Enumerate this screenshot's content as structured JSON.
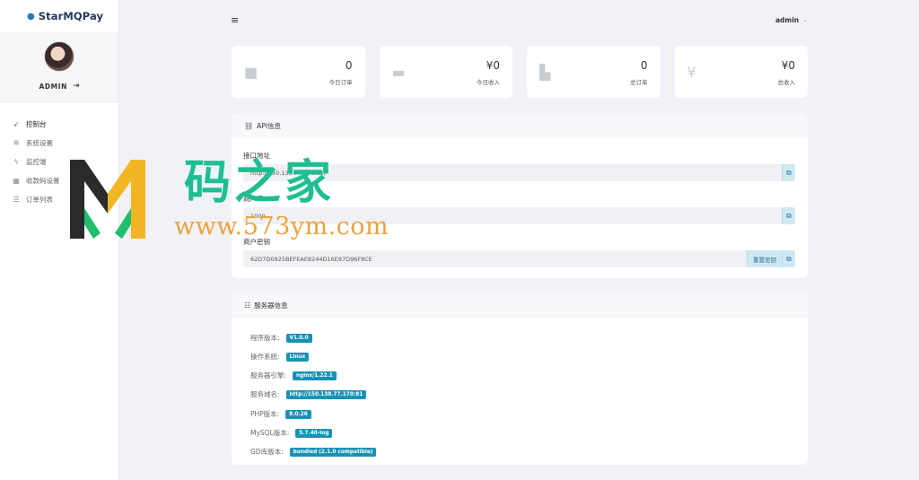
{
  "brand": {
    "name": "StarMQPay",
    "icon": "drop-icon"
  },
  "profile": {
    "name": "ADMIN",
    "logout_icon": "logout-icon"
  },
  "nav": [
    {
      "label": "控制台",
      "icon": "rocket-icon",
      "active": true
    },
    {
      "label": "系统设置",
      "icon": "gear-icon"
    },
    {
      "label": "监控端",
      "icon": "bolt-icon"
    },
    {
      "label": "收款码设置",
      "icon": "grid-icon"
    },
    {
      "label": "订单列表",
      "icon": "list-icon"
    }
  ],
  "header": {
    "user": "admin"
  },
  "stats": [
    {
      "value": "0",
      "label": "今日订单",
      "icon": "bag-icon"
    },
    {
      "value": "¥0",
      "label": "今日收入",
      "icon": "wallet-icon"
    },
    {
      "value": "0",
      "label": "总订单",
      "icon": "chart-icon"
    },
    {
      "value": "¥0",
      "label": "总收入",
      "icon": "yen-icon"
    }
  ],
  "api": {
    "title": "API信息",
    "url_label": "接口地址",
    "url_value": "http://150.138.77.170:81/",
    "merchant_label": "商户ID",
    "merchant_value": "1000",
    "secret_label": "商户密钥",
    "secret_value": "62D7D0925BEFEAE8244D16E97D96F8CE",
    "reset_label": "重置密钥"
  },
  "server": {
    "title": "服务器信息",
    "rows": [
      {
        "label": "程序版本:",
        "value": "V1.0.0"
      },
      {
        "label": "操作系统:",
        "value": "Linux"
      },
      {
        "label": "服务器引擎:",
        "value": "nginx/1.22.1"
      },
      {
        "label": "服务域名:",
        "value": "http://150.138.77.170:81"
      },
      {
        "label": "PHP版本:",
        "value": "8.0.26"
      },
      {
        "label": "MySQL版本:",
        "value": "5.7.40-log"
      },
      {
        "label": "GD库版本:",
        "value": "bundled (2.1.0 compatible)"
      }
    ]
  },
  "watermark": {
    "title": "码之家",
    "url": "www.573ym.com"
  },
  "colors": {
    "accent": "#1792b5",
    "brand": "#23395d",
    "watermark_green": "#1fbe92",
    "watermark_orange": "#efa13a"
  }
}
